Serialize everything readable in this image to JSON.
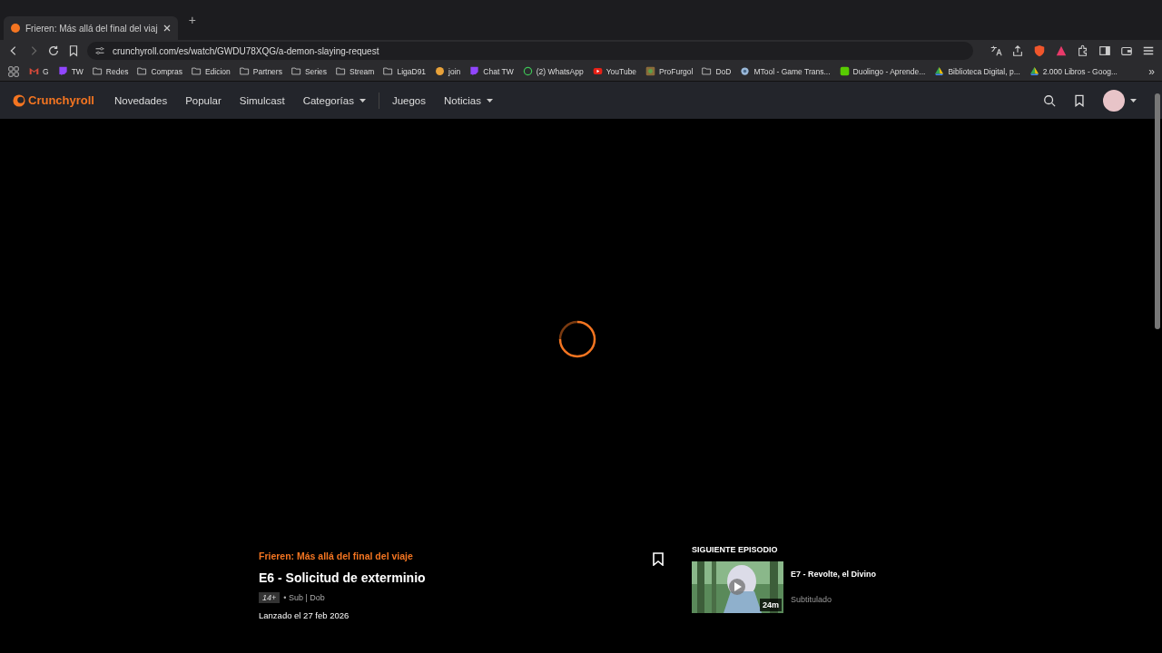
{
  "browser": {
    "tabs": [
      {
        "title": "Frieren: Más allá del final del viaj",
        "selected": true
      }
    ],
    "new_tab": "+",
    "address": "crunchyroll.com/es/watch/GWDU78XQG/a-demon-slaying-request",
    "bookmarks": [
      {
        "label": "G",
        "kind": "gmail"
      },
      {
        "label": "TW",
        "kind": "twitch"
      },
      {
        "label": "Redes",
        "kind": "folder"
      },
      {
        "label": "Compras",
        "kind": "folder"
      },
      {
        "label": "Edicion",
        "kind": "folder"
      },
      {
        "label": "Partners",
        "kind": "folder"
      },
      {
        "label": "Series",
        "kind": "folder"
      },
      {
        "label": "Stream",
        "kind": "folder"
      },
      {
        "label": "LigaD91",
        "kind": "folder"
      },
      {
        "label": "join",
        "kind": "circle"
      },
      {
        "label": "Chat TW",
        "kind": "twitch"
      },
      {
        "label": "(2) WhatsApp",
        "kind": "whatsapp"
      },
      {
        "label": "YouTube",
        "kind": "youtube"
      },
      {
        "label": "ProFurgol",
        "kind": "app"
      },
      {
        "label": "DoD",
        "kind": "folder"
      },
      {
        "label": "MTool - Game Trans...",
        "kind": "globe"
      },
      {
        "label": "Duolingo - Aprende...",
        "kind": "duo"
      },
      {
        "label": "Biblioteca Digital, p...",
        "kind": "drive"
      },
      {
        "label": "2.000 Libros - Goog...",
        "kind": "drive"
      }
    ],
    "more": "»"
  },
  "site": {
    "logo": "Crunchyroll",
    "nav": [
      {
        "label": "Novedades",
        "dropdown": false
      },
      {
        "label": "Popular",
        "dropdown": false
      },
      {
        "label": "Simulcast",
        "dropdown": false
      },
      {
        "label": "Categorías",
        "dropdown": true
      },
      {
        "label": "Juegos",
        "dropdown": false
      },
      {
        "label": "Noticias",
        "dropdown": true
      }
    ]
  },
  "episode": {
    "series": "Frieren: Más allá del final del viaje",
    "title": "E6 - Solicitud de exterminio",
    "rating": "14+",
    "audio": "• Sub | Dob",
    "release": "Lanzado el 27 feb 2026"
  },
  "next": {
    "heading": "SIGUIENTE EPISODIO",
    "title": "E7 - Revolte, el Divino",
    "duration": "24m",
    "subtitle": "Subtitulado"
  }
}
